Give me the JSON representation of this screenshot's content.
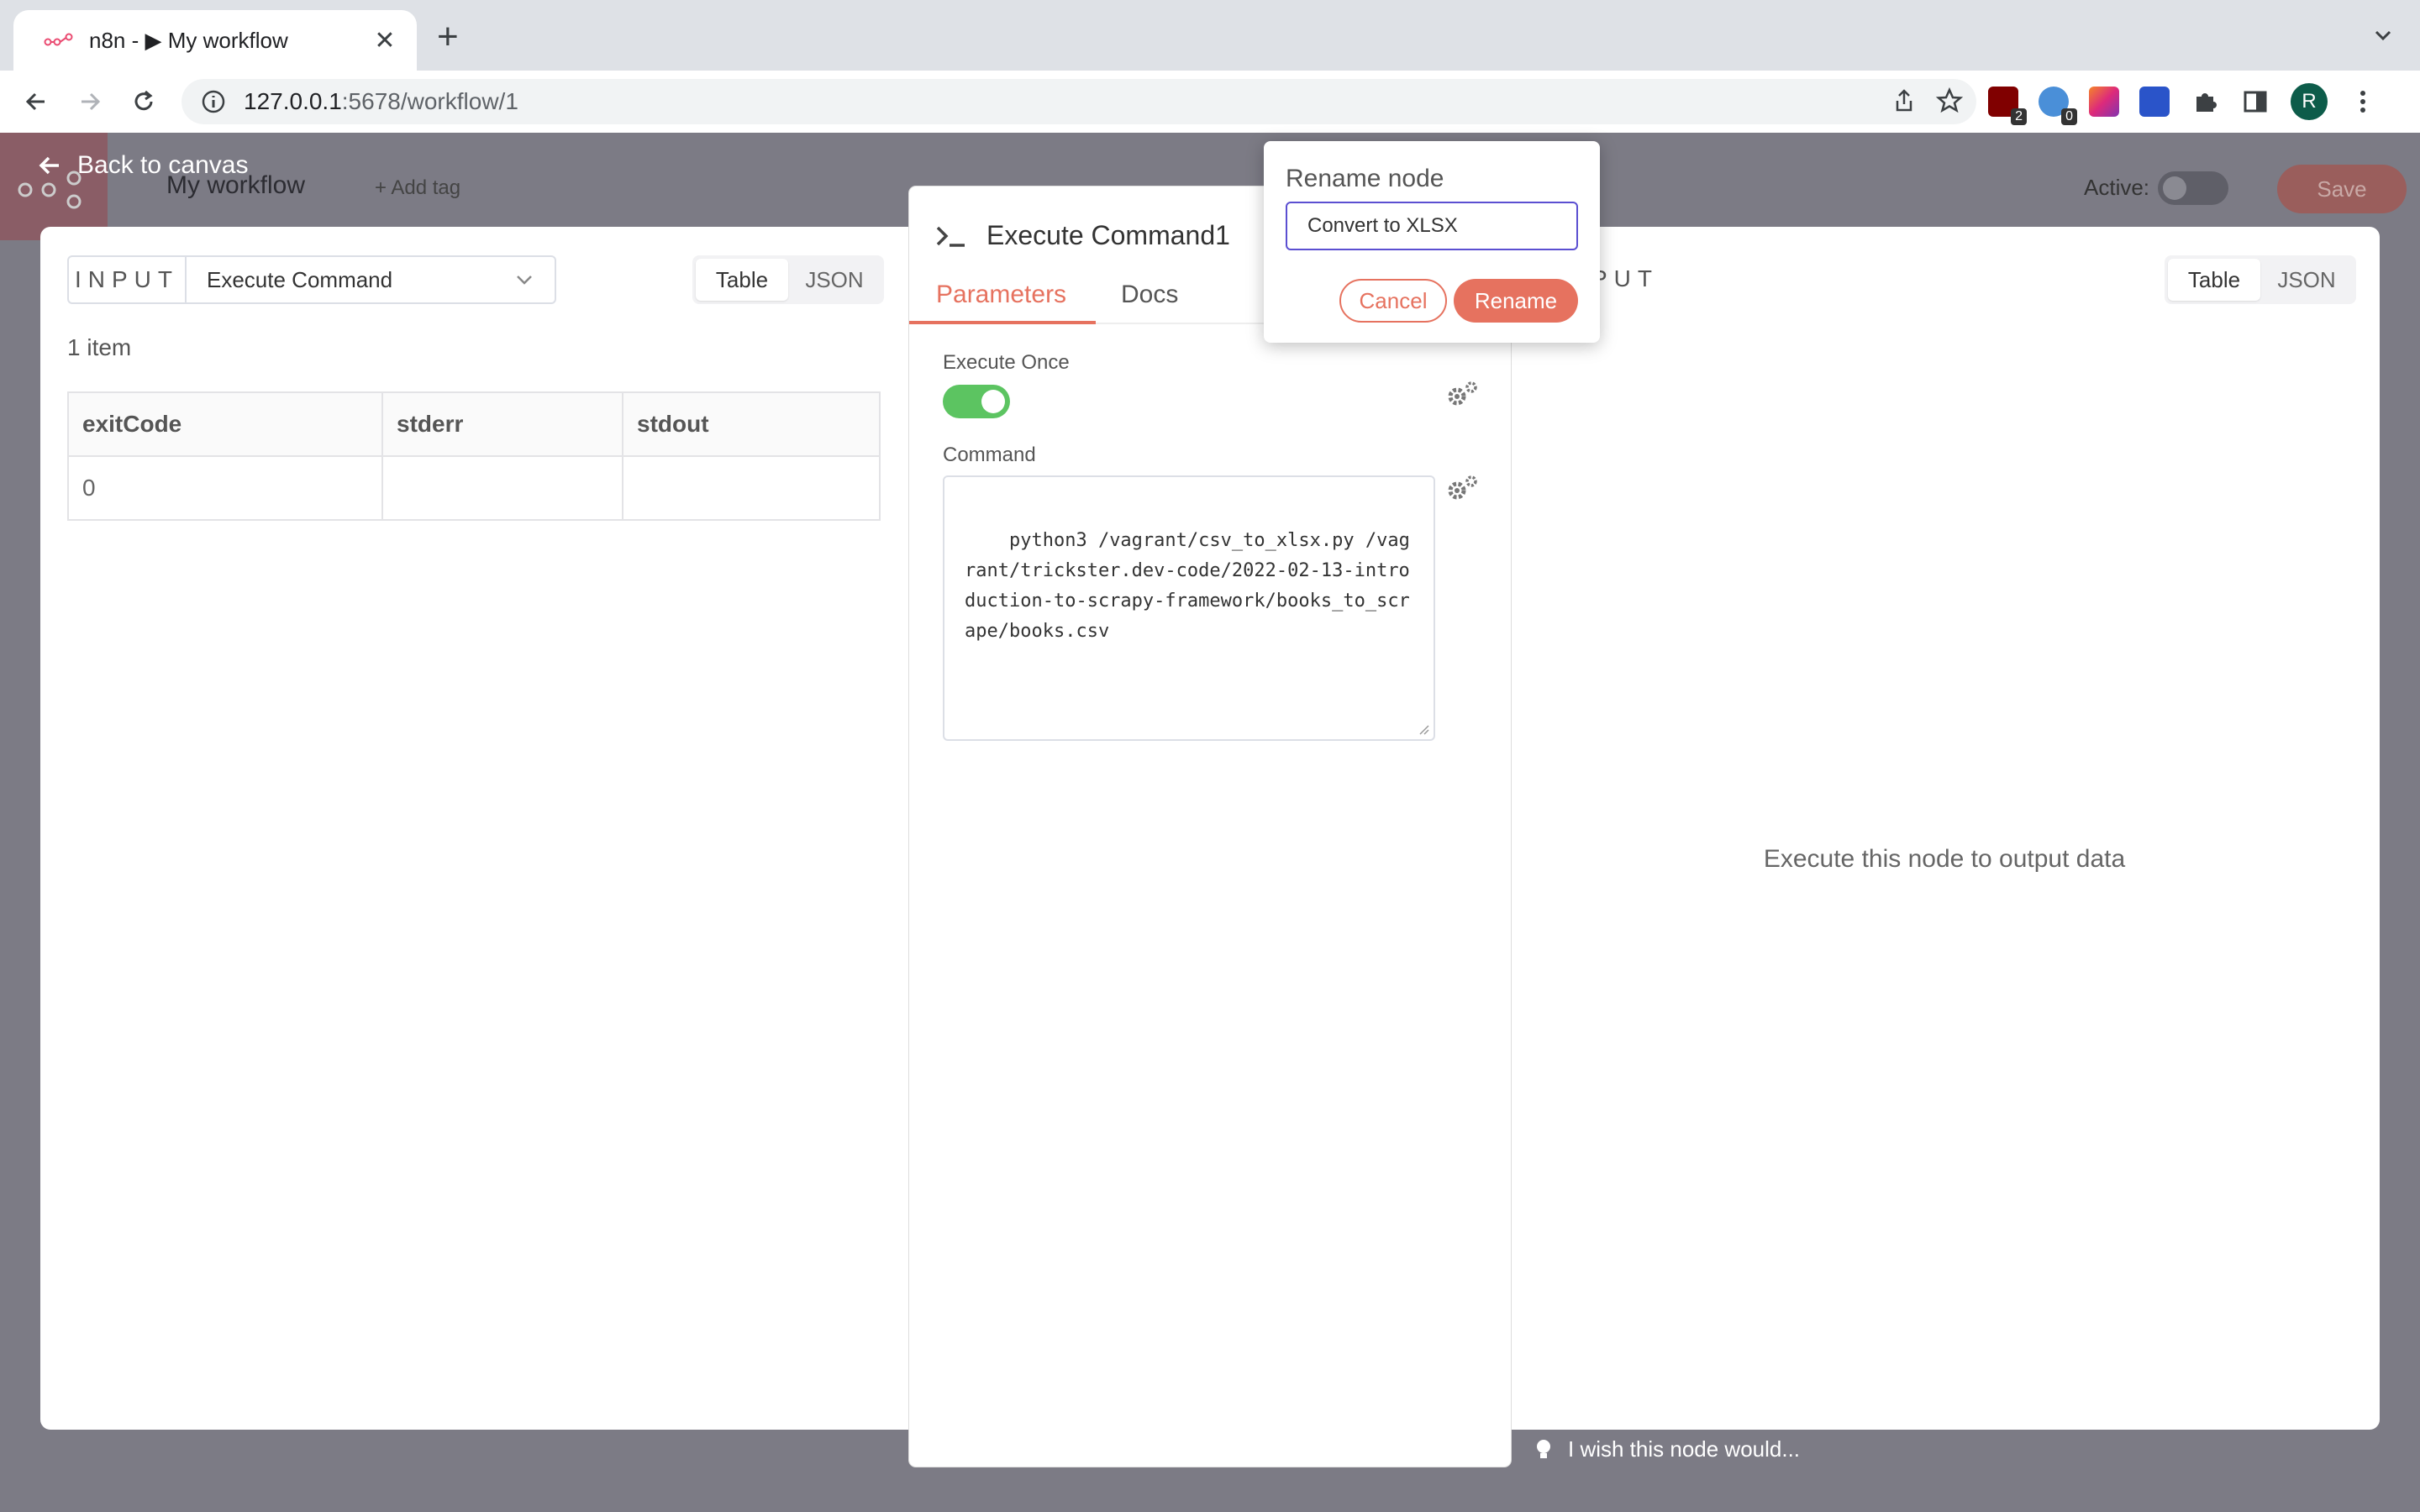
{
  "browser": {
    "tab_title": "n8n - ▶ My workflow",
    "url_host": "127.0.0.1",
    "url_rest": ":5678/workflow/1",
    "ext_badges": [
      "2",
      "0"
    ],
    "avatar_letter": "R"
  },
  "app": {
    "workflow_name": "My workflow",
    "add_tag": "+ Add tag",
    "active_label": "Active:",
    "active": false,
    "save_label": "Save",
    "back_label": "Back to canvas"
  },
  "input_panel": {
    "label": "INPUT",
    "source_node": "Execute Command",
    "views": [
      "Table",
      "JSON"
    ],
    "active_view": "Table",
    "item_count": "1 item",
    "columns": [
      "exitCode",
      "stderr",
      "stdout"
    ],
    "rows": [
      [
        "0",
        "",
        ""
      ]
    ]
  },
  "node": {
    "title": "Execute Command1",
    "tabs": [
      "Parameters",
      "Docs"
    ],
    "active_tab": "Parameters",
    "execute_once_label": "Execute Once",
    "execute_once": true,
    "command_label": "Command",
    "command_value": "python3 /vagrant/csv_to_xlsx.py /vagrant/trickster.dev-code/2022-02-13-introduction-to-scrapy-framework/books_to_scrape/books.csv"
  },
  "output_panel": {
    "label": "PUT",
    "views": [
      "Table",
      "JSON"
    ],
    "active_view": "Table",
    "empty_message": "Execute this node to output data"
  },
  "rename_popover": {
    "title": "Rename node",
    "value": "Convert to XLSX",
    "cancel_label": "Cancel",
    "rename_label": "Rename"
  },
  "feedback": "I wish this node would...",
  "colors": {
    "accent": "#e6725f",
    "toggle_on": "#5cc461",
    "focus": "#5b4fd1"
  }
}
